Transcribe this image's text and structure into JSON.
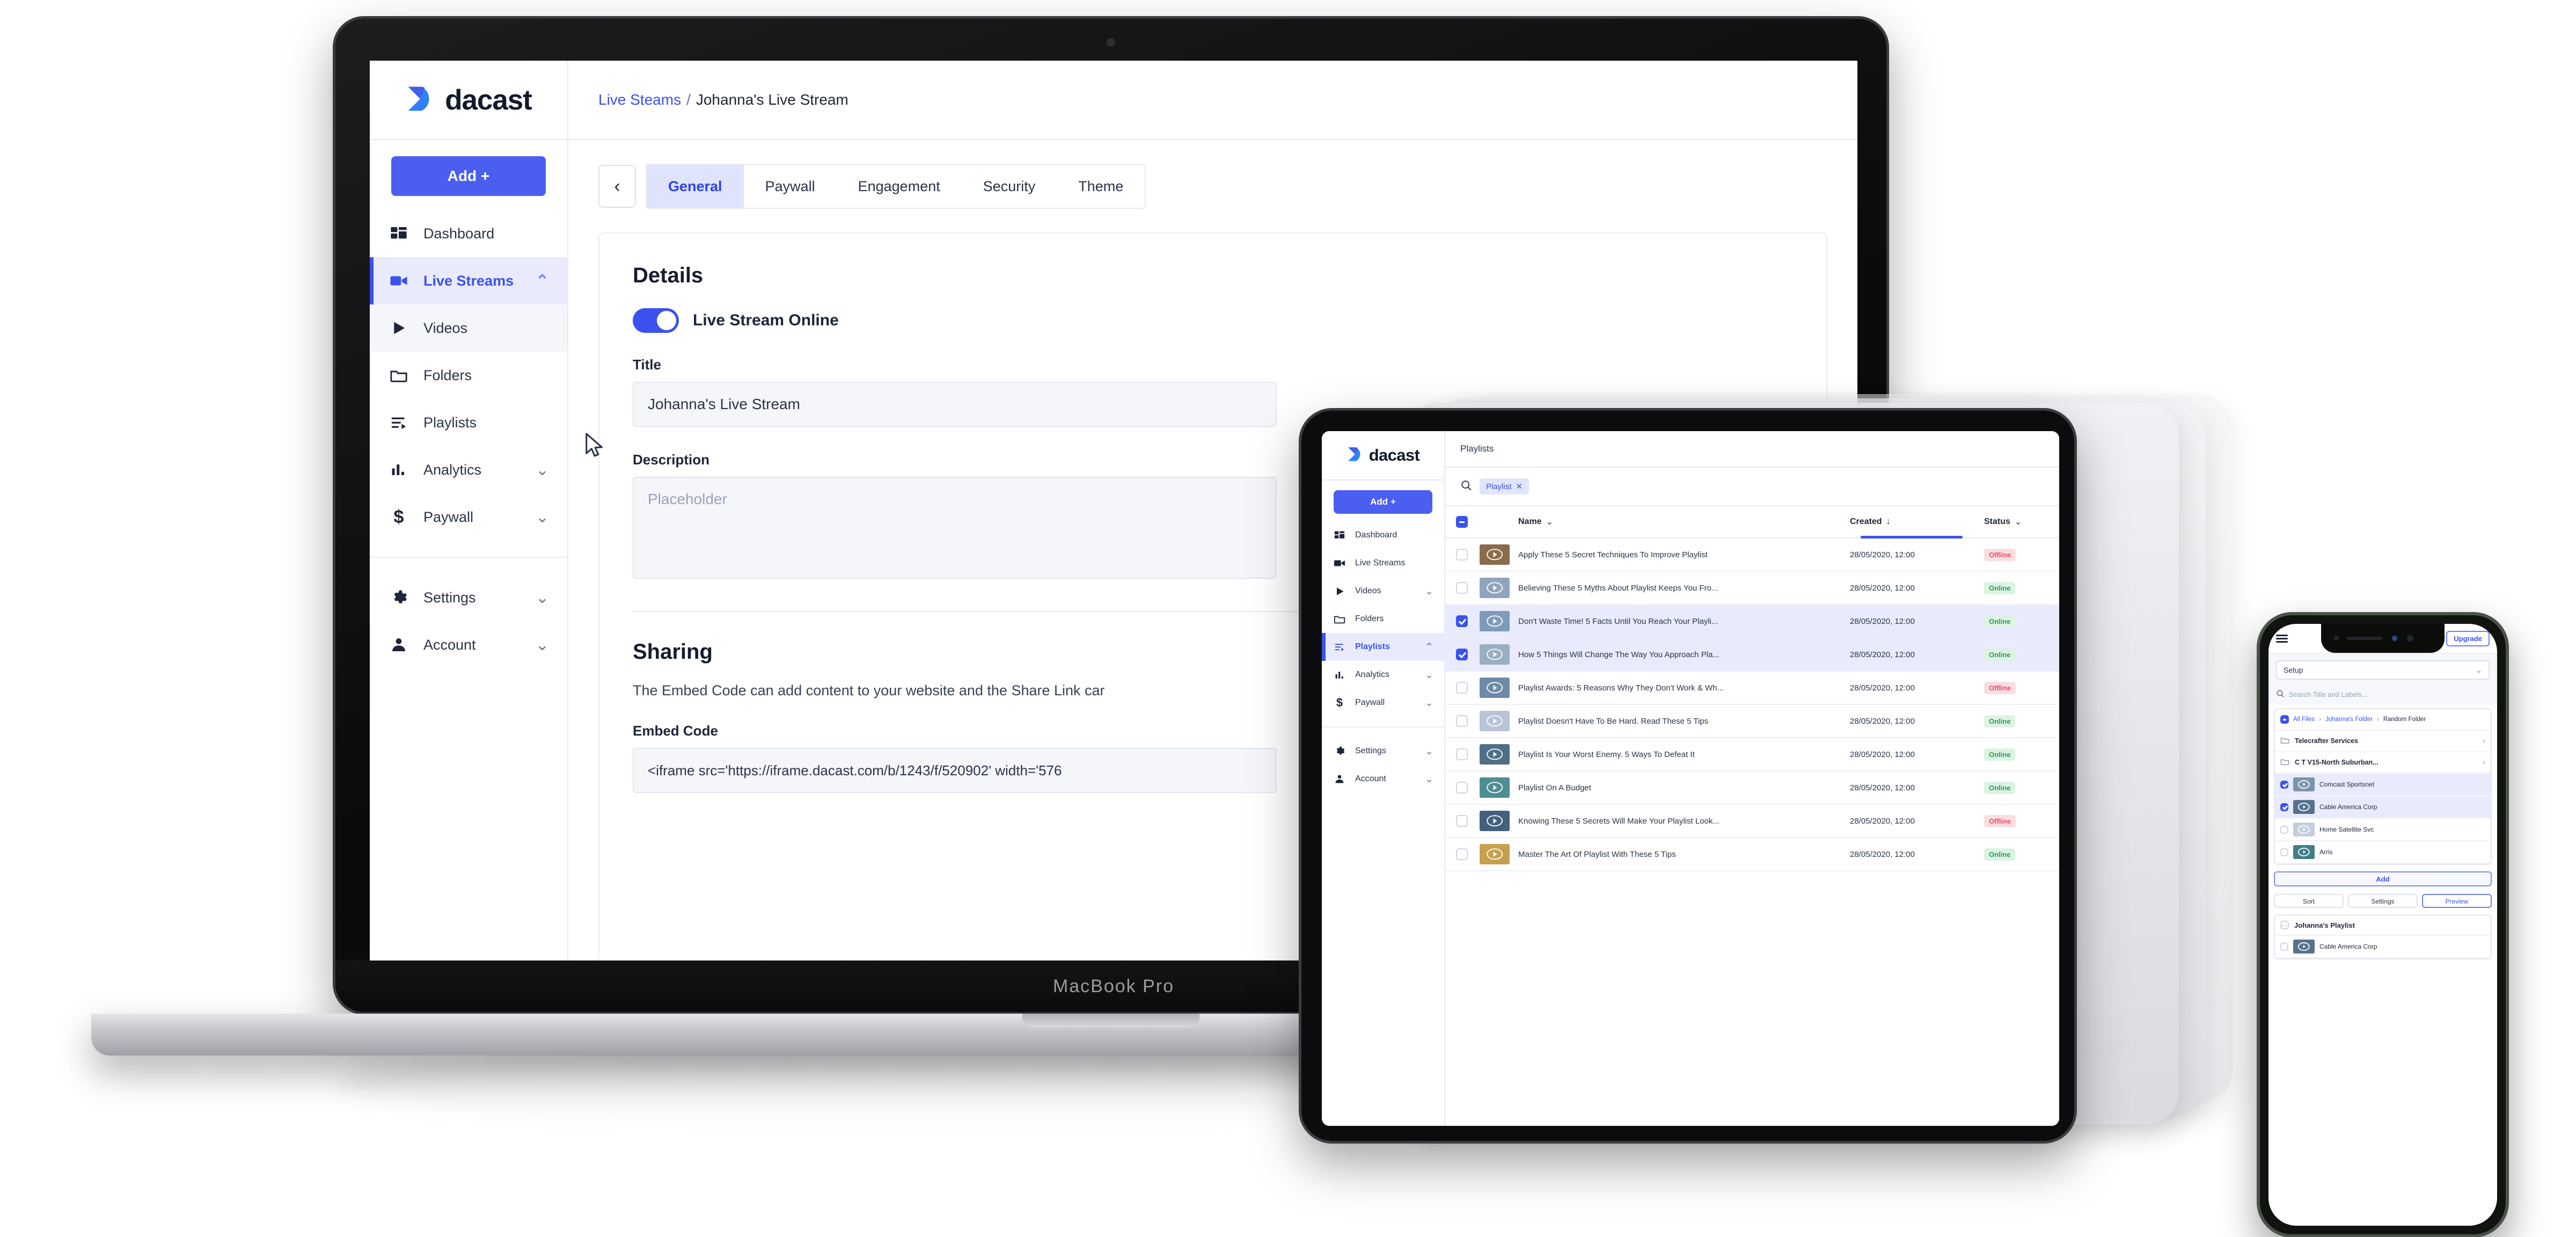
{
  "brand": {
    "name": "dacast",
    "accent": "#4a5ff0",
    "accent_dark": "#3b52ee",
    "logo_icon": "dacast-logo-icon"
  },
  "laptop": {
    "device_label": "MacBook Pro",
    "sidebar": {
      "add_button": "Add +",
      "items": [
        {
          "label": "Dashboard",
          "icon": "dashboard-icon",
          "state": "default",
          "chevron": ""
        },
        {
          "label": "Live Streams",
          "icon": "video-camera-icon",
          "state": "active",
          "chevron": "⌃"
        },
        {
          "label": "Videos",
          "icon": "play-icon",
          "state": "hover",
          "chevron": ""
        },
        {
          "label": "Folders",
          "icon": "folder-icon",
          "state": "default",
          "chevron": ""
        },
        {
          "label": "Playlists",
          "icon": "playlist-icon",
          "state": "default",
          "chevron": ""
        },
        {
          "label": "Analytics",
          "icon": "bar-chart-icon",
          "state": "default",
          "chevron": "⌄"
        },
        {
          "label": "Paywall",
          "icon": "dollar-icon",
          "state": "default",
          "chevron": "⌄"
        }
      ],
      "footer_items": [
        {
          "label": "Settings",
          "icon": "gear-icon",
          "chevron": "⌄"
        },
        {
          "label": "Account",
          "icon": "person-icon",
          "chevron": "⌄"
        }
      ]
    },
    "breadcrumb": {
      "parent": "Live Steams",
      "separator": "/",
      "current": "Johanna's Live Stream"
    },
    "back_button_icon": "chevron-left-icon",
    "tabs": [
      {
        "label": "General",
        "active": true
      },
      {
        "label": "Paywall",
        "active": false
      },
      {
        "label": "Engagement",
        "active": false
      },
      {
        "label": "Security",
        "active": false
      },
      {
        "label": "Theme",
        "active": false
      }
    ],
    "details": {
      "heading": "Details",
      "toggle_label": "Live Stream Online",
      "toggle_on": true,
      "title_label": "Title",
      "title_value": "Johanna's Live Stream",
      "description_label": "Description",
      "description_placeholder": "Placeholder"
    },
    "sharing": {
      "heading": "Sharing",
      "intro": "The Embed Code can add content to your website and the Share Link car",
      "embed_label": "Embed Code",
      "embed_value": "<iframe src='https://iframe.dacast.com/b/1243/f/520902' width='576"
    }
  },
  "tablet": {
    "sidebar": {
      "add_button": "Add +",
      "items": [
        {
          "label": "Dashboard",
          "icon": "dashboard-icon",
          "state": "default",
          "chevron": ""
        },
        {
          "label": "Live Streams",
          "icon": "video-camera-icon",
          "state": "default",
          "chevron": ""
        },
        {
          "label": "Videos",
          "icon": "play-icon",
          "state": "default",
          "chevron": "⌄"
        },
        {
          "label": "Folders",
          "icon": "folder-icon",
          "state": "default",
          "chevron": ""
        },
        {
          "label": "Playlists",
          "icon": "playlist-icon",
          "state": "active",
          "chevron": "⌃"
        },
        {
          "label": "Analytics",
          "icon": "bar-chart-icon",
          "state": "default",
          "chevron": "⌄"
        },
        {
          "label": "Paywall",
          "icon": "dollar-icon",
          "state": "default",
          "chevron": "⌄"
        }
      ],
      "footer_items": [
        {
          "label": "Settings",
          "icon": "gear-icon",
          "chevron": "⌄"
        },
        {
          "label": "Account",
          "icon": "person-icon",
          "chevron": "⌄"
        }
      ]
    },
    "page_title": "Playlists",
    "search_icon": "search-icon",
    "filter_chip": {
      "label": "Playlist",
      "remove_icon": "✕"
    },
    "table": {
      "header_checkbox_state": "indeterminate",
      "columns": [
        {
          "label": "Name",
          "sort_icon": "⌄",
          "sorted": false
        },
        {
          "label": "Created",
          "sort_icon": "↓",
          "sorted": true
        },
        {
          "label": "Status",
          "sort_icon": "⌄",
          "sorted": false
        }
      ],
      "rows": [
        {
          "name": "Apply These 5 Secret Techniques To Improve Playlist",
          "created": "28/05/2020, 12:00",
          "status": "Offline",
          "checked": false,
          "thumb": "#8a6b4a"
        },
        {
          "name": "Believing These 5 Myths About Playlist Keeps You Fro...",
          "created": "28/05/2020, 12:00",
          "status": "Online",
          "checked": false,
          "thumb": "#8fa5bd"
        },
        {
          "name": "Don't Waste Time! 5 Facts Until You Reach Your Playli...",
          "created": "28/05/2020, 12:00",
          "status": "Online",
          "checked": true,
          "thumb": "#7e9bb8"
        },
        {
          "name": "How 5 Things Will Change The Way You Approach Pla...",
          "created": "28/05/2020, 12:00",
          "status": "Online",
          "checked": true,
          "thumb": "#9aaec2"
        },
        {
          "name": "Playlist Awards: 5 Reasons Why They Don't Work & Wh...",
          "created": "28/05/2020, 12:00",
          "status": "Offline",
          "checked": false,
          "thumb": "#6d8ba8"
        },
        {
          "name": "Playlist Doesn't Have To Be Hard. Read These 5 Tips",
          "created": "28/05/2020, 12:00",
          "status": "Online",
          "checked": false,
          "thumb": "#b6c4d6"
        },
        {
          "name": "Playlist Is Your Worst Enemy. 5 Ways To Defeat It",
          "created": "28/05/2020, 12:00",
          "status": "Online",
          "checked": false,
          "thumb": "#4f6f86"
        },
        {
          "name": "Playlist On A Budget",
          "created": "28/05/2020, 12:00",
          "status": "Online",
          "checked": false,
          "thumb": "#4e8d92"
        },
        {
          "name": "Knowing These 5 Secrets Will Make Your Playlist Look...",
          "created": "28/05/2020, 12:00",
          "status": "Offline",
          "checked": false,
          "thumb": "#44607d"
        },
        {
          "name": "Master The Art Of Playlist With These 5 Tips",
          "created": "28/05/2020, 12:00",
          "status": "Online",
          "checked": false,
          "thumb": "#c6a04e"
        }
      ]
    }
  },
  "phone": {
    "menu_icon": "hamburger-menu-icon",
    "upgrade_button": "Upgrade",
    "setup_select": {
      "value": "Setup",
      "chevron": "⌄"
    },
    "search_placeholder": "Search Title and Labels...",
    "search_icon": "search-icon",
    "breadcrumb": {
      "checkbox_state": "indeterminate",
      "parts": [
        "All Files",
        "Johanna's Folder",
        "Random Folder"
      ],
      "separator": "›"
    },
    "folders": [
      {
        "label": "Telecrafter Services",
        "icon": "folder-icon",
        "chevron": "›"
      },
      {
        "label": "C T V15-North Suburban...",
        "icon": "folder-icon",
        "chevron": "›"
      }
    ],
    "media_items": [
      {
        "label": "Comcast Sportsnet",
        "checked": true,
        "thumb": "#7b93ad"
      },
      {
        "label": "Cable America Corp",
        "checked": true,
        "thumb": "#56728c"
      },
      {
        "label": "Home Satellite Svc",
        "checked": false,
        "thumb": "#c4cedd"
      },
      {
        "label": "Arris",
        "checked": false,
        "thumb": "#3f7f86"
      }
    ],
    "add_button": "Add",
    "footer_buttons": [
      {
        "label": "Sort",
        "primary": false
      },
      {
        "label": "Settings",
        "primary": false
      },
      {
        "label": "Preview",
        "primary": true
      }
    ],
    "playlist_group": {
      "checkbox_state": "indeterminate",
      "label": "Johanna's Playlist",
      "items": [
        {
          "label": "Cable America Corp",
          "checked": false,
          "thumb": "#56728c"
        }
      ]
    }
  }
}
